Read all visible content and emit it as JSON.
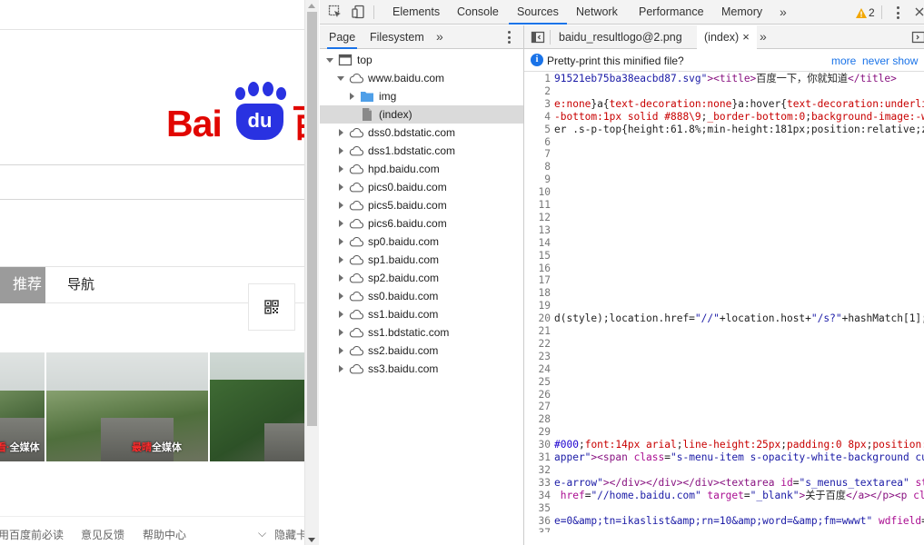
{
  "page": {
    "logo_text_bai": "Bai",
    "logo_text_du": "du",
    "logo_text_b": "百",
    "tabs": [
      {
        "label": "推荐"
      },
      {
        "label": "导航"
      }
    ],
    "news_images": [
      {
        "caption_red": "看·",
        "caption_white": "全媒体"
      },
      {
        "caption_red": "最晴",
        "caption_white": "全媒体"
      },
      {
        "caption_red": "",
        "caption_white": ""
      }
    ],
    "footer_links": [
      "用百度前必读",
      "意见反馈",
      "帮助中心",
      "隐藏卡"
    ]
  },
  "devtools": {
    "tabs": [
      "Elements",
      "Console",
      "Sources",
      "Network",
      "Performance",
      "Memory"
    ],
    "active_tab": "Sources",
    "warning_count": "2",
    "navigator_tabs": [
      "Page",
      "Filesystem"
    ],
    "tree": [
      {
        "label": "top",
        "icon": "frame-icon",
        "expand": "d",
        "level": 0
      },
      {
        "label": "www.baidu.com",
        "icon": "cloud-icon",
        "expand": "d",
        "level": 1
      },
      {
        "label": "img",
        "icon": "folder-icon",
        "expand": "r",
        "level": 2
      },
      {
        "label": "(index)",
        "icon": "file-icon",
        "expand": "n",
        "level": 2,
        "selected": true
      },
      {
        "label": "dss0.bdstatic.com",
        "icon": "cloud-icon",
        "expand": "r",
        "level": 1
      },
      {
        "label": "dss1.bdstatic.com",
        "icon": "cloud-icon",
        "expand": "r",
        "level": 1
      },
      {
        "label": "hpd.baidu.com",
        "icon": "cloud-icon",
        "expand": "r",
        "level": 1
      },
      {
        "label": "pics0.baidu.com",
        "icon": "cloud-icon",
        "expand": "r",
        "level": 1
      },
      {
        "label": "pics5.baidu.com",
        "icon": "cloud-icon",
        "expand": "r",
        "level": 1
      },
      {
        "label": "pics6.baidu.com",
        "icon": "cloud-icon",
        "expand": "r",
        "level": 1
      },
      {
        "label": "sp0.baidu.com",
        "icon": "cloud-icon",
        "expand": "r",
        "level": 1
      },
      {
        "label": "sp1.baidu.com",
        "icon": "cloud-icon",
        "expand": "r",
        "level": 1
      },
      {
        "label": "sp2.baidu.com",
        "icon": "cloud-icon",
        "expand": "r",
        "level": 1
      },
      {
        "label": "ss0.baidu.com",
        "icon": "cloud-icon",
        "expand": "r",
        "level": 1
      },
      {
        "label": "ss1.baidu.com",
        "icon": "cloud-icon",
        "expand": "r",
        "level": 1
      },
      {
        "label": "ss1.bdstatic.com",
        "icon": "cloud-icon",
        "expand": "r",
        "level": 1
      },
      {
        "label": "ss2.baidu.com",
        "icon": "cloud-icon",
        "expand": "r",
        "level": 1
      },
      {
        "label": "ss3.baidu.com",
        "icon": "cloud-icon",
        "expand": "r",
        "level": 1
      }
    ],
    "editor_tabs": [
      {
        "label": "baidu_resultlogo@2.png",
        "active": false
      },
      {
        "label": "(index)",
        "active": true,
        "close": "×"
      }
    ],
    "infobar": {
      "text": "Pretty-print this minified file?",
      "more": "more",
      "never_show": "never show"
    },
    "code_lines": [
      {
        "n": "1",
        "parts": [
          [
            "str",
            "91521eb75ba38eacbd87.svg\""
          ],
          [
            "tag",
            ">"
          ],
          [
            "tag",
            "<title>"
          ],
          [
            "txt",
            "百度一下，你就知道"
          ],
          [
            "tag",
            "</title>"
          ]
        ]
      },
      {
        "n": "2",
        "parts": []
      },
      {
        "n": "3",
        "parts": [
          [
            "prop",
            "e:none"
          ],
          [
            "txt",
            "}a{"
          ],
          [
            "prop",
            "text-decoration:none"
          ],
          [
            "txt",
            "}a:hover{"
          ],
          [
            "prop",
            "text-decoration:underlin"
          ]
        ]
      },
      {
        "n": "4",
        "parts": [
          [
            "prop",
            "-bottom:1px solid #888\\9"
          ],
          [
            "txt",
            ";"
          ],
          [
            "prop",
            "_border-bottom:0"
          ],
          [
            "txt",
            ";"
          ],
          [
            "prop",
            "background-image:-we"
          ]
        ]
      },
      {
        "n": "5",
        "parts": [
          [
            "txt",
            "er .s-p-top{height:61.8%;min-height:181px;position:relative;z-"
          ]
        ]
      },
      {
        "n": "6",
        "parts": []
      },
      {
        "n": "7",
        "parts": []
      },
      {
        "n": "8",
        "parts": []
      },
      {
        "n": "9",
        "parts": []
      },
      {
        "n": "10",
        "parts": []
      },
      {
        "n": "11",
        "parts": []
      },
      {
        "n": "12",
        "parts": []
      },
      {
        "n": "13",
        "parts": []
      },
      {
        "n": "14",
        "parts": []
      },
      {
        "n": "15",
        "parts": []
      },
      {
        "n": "16",
        "parts": []
      },
      {
        "n": "17",
        "parts": []
      },
      {
        "n": "18",
        "parts": []
      },
      {
        "n": "19",
        "parts": []
      },
      {
        "n": "20",
        "parts": [
          [
            "txt",
            "d(style);location.href="
          ],
          [
            "str",
            "\"//\""
          ],
          [
            "txt",
            "+location.host+"
          ],
          [
            "str",
            "\"/s?\""
          ],
          [
            "txt",
            "+hashMatch[1];}"
          ]
        ]
      },
      {
        "n": "21",
        "parts": []
      },
      {
        "n": "22",
        "parts": []
      },
      {
        "n": "23",
        "parts": []
      },
      {
        "n": "24",
        "parts": []
      },
      {
        "n": "25",
        "parts": []
      },
      {
        "n": "26",
        "parts": []
      },
      {
        "n": "27",
        "parts": []
      },
      {
        "n": "28",
        "parts": []
      },
      {
        "n": "29",
        "parts": []
      },
      {
        "n": "30",
        "parts": [
          [
            "num",
            "#000"
          ],
          [
            "txt",
            ";"
          ],
          [
            "prop",
            "font:14px arial"
          ],
          [
            "txt",
            ";"
          ],
          [
            "prop",
            "line-height:25px"
          ],
          [
            "txt",
            ";"
          ],
          [
            "prop",
            "padding:0 8px"
          ],
          [
            "txt",
            ";"
          ],
          [
            "prop",
            "position:r"
          ]
        ]
      },
      {
        "n": "31",
        "parts": [
          [
            "str",
            "apper\""
          ],
          [
            "tag",
            "><span "
          ],
          [
            "kw",
            "class"
          ],
          [
            "txt",
            "="
          ],
          [
            "str",
            "\"s-menu-item s-opacity-white-background cur"
          ]
        ]
      },
      {
        "n": "32",
        "parts": []
      },
      {
        "n": "33",
        "parts": [
          [
            "str",
            "e-arrow\""
          ],
          [
            "tag",
            "></div></div></div><textarea "
          ],
          [
            "kw",
            "id"
          ],
          [
            "txt",
            "="
          ],
          [
            "str",
            "\"s_menus_textarea\""
          ],
          [
            "kw",
            " sty"
          ]
        ]
      },
      {
        "n": "34",
        "parts": [
          [
            "kw",
            " href"
          ],
          [
            "txt",
            "="
          ],
          [
            "str",
            "\"//home.baidu.com\""
          ],
          [
            "kw",
            " target"
          ],
          [
            "txt",
            "="
          ],
          [
            "str",
            "\"_blank\""
          ],
          [
            "tag",
            ">"
          ],
          [
            "txt",
            "关于百度"
          ],
          [
            "tag",
            "</a></p><p "
          ],
          [
            "kw",
            "cla"
          ]
        ]
      },
      {
        "n": "35",
        "parts": []
      },
      {
        "n": "36",
        "parts": [
          [
            "str",
            "e=0&amp;tn=ikaslist&amp;rn=10&amp;word=&amp;fm=wwwt\""
          ],
          [
            "kw",
            " wdfield"
          ],
          [
            "txt",
            "="
          ]
        ]
      },
      {
        "n": "37",
        "parts": []
      }
    ]
  }
}
